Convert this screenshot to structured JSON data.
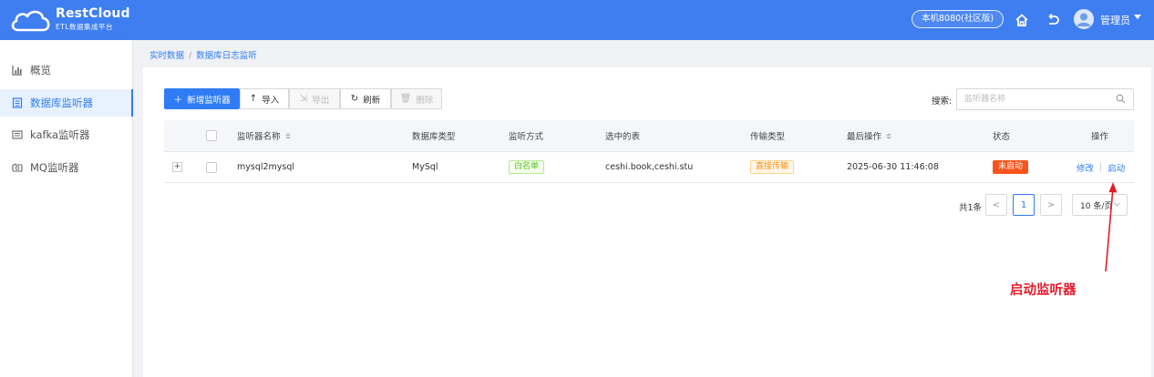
{
  "header": {
    "logo_title": "RestCloud",
    "logo_subtitle": "ETL数据集成平台",
    "edition_badge": "本机8080(社区版)",
    "user_name": "管理员",
    "bg_color": "#3f7ef0"
  },
  "sidebar": {
    "items": [
      {
        "label": "概览",
        "icon": "bar-chart-icon",
        "active": false
      },
      {
        "label": "数据库监听器",
        "icon": "database-list-icon",
        "active": true
      },
      {
        "label": "kafka监听器",
        "icon": "kafka-icon",
        "active": false
      },
      {
        "label": "MQ监听器",
        "icon": "message-queue-icon",
        "active": false
      }
    ]
  },
  "breadcrumb": [
    "实时数据",
    "数据库日志监听"
  ],
  "toolbar": {
    "add_label": "新增监听器",
    "import_label": "导入",
    "export_label": "导出",
    "refresh_label": "刷新",
    "delete_label": "删除"
  },
  "search": {
    "label": "搜索:",
    "placeholder": "监听器名称",
    "value": ""
  },
  "table": {
    "columns": [
      "监听器名称",
      "数据库类型",
      "监听方式",
      "选中的表",
      "传输类型",
      "最后操作",
      "状态",
      "操作"
    ],
    "rows": [
      {
        "expand": "+",
        "name": "mysql2mysql",
        "db_type": "MySql",
        "listen_mode": "白名单",
        "tables": "ceshi.book,ceshi.stu",
        "transfer_type": "直接传输",
        "last_op": "2025-06-30 11:46:08",
        "status": "未启动",
        "action_edit": "修改",
        "action_start": "启动"
      }
    ]
  },
  "pagination": {
    "total": "共1条",
    "prev": "<",
    "current_page": "1",
    "next": ">",
    "page_size": "10 条/页"
  },
  "annotation": {
    "text": "启动监听器",
    "color": "#e41b2b"
  },
  "colors": {
    "primary": "#2f7cf6",
    "status_stopped": "#fa541c",
    "tag_green": "#52c41a",
    "tag_orange": "#fa8c16"
  }
}
